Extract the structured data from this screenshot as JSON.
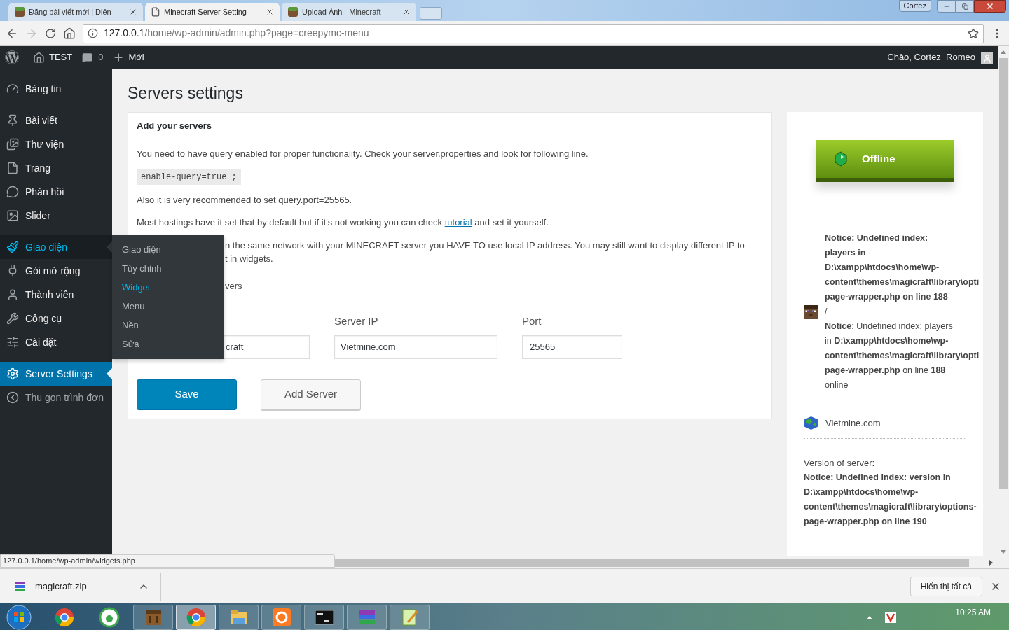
{
  "browser": {
    "tabs": [
      {
        "title": "Đăng bài viết mới | Diễn",
        "selected": false
      },
      {
        "title": "Minecraft Server Setting",
        "selected": true
      },
      {
        "title": "Upload Ảnh - Minecraft",
        "selected": false
      }
    ],
    "profile": "Cortez",
    "url_host": "127.0.0.1",
    "url_path": "/home/wp-admin/admin.php?page=creepymc-menu"
  },
  "admin_bar": {
    "site": "TEST",
    "comments": "0",
    "new": "Mới",
    "greeting": "Chào, Cortez_Romeo"
  },
  "sidebar": {
    "groups": [
      [
        {
          "label": "Bảng tin",
          "selected": false,
          "hovered": false
        }
      ],
      [
        {
          "label": "Bài viết",
          "selected": false,
          "hovered": false
        },
        {
          "label": "Thư viện",
          "selected": false,
          "hovered": false
        },
        {
          "label": "Trang",
          "selected": false,
          "hovered": false
        },
        {
          "label": "Phản hồi",
          "selected": false,
          "hovered": false
        },
        {
          "label": "Slider",
          "selected": false,
          "hovered": false
        }
      ],
      [
        {
          "label": "Giao diện",
          "selected": false,
          "hovered": true
        },
        {
          "label": "Gói mở rộng",
          "selected": false,
          "hovered": false
        },
        {
          "label": "Thành viên",
          "selected": false,
          "hovered": false
        },
        {
          "label": "Công cụ",
          "selected": false,
          "hovered": false
        },
        {
          "label": "Cài đặt",
          "selected": false,
          "hovered": false
        }
      ],
      [
        {
          "label": "Server Settings",
          "selected": true,
          "hovered": false
        },
        {
          "label": "Thu gọn trình đơn",
          "selected": false,
          "hovered": false
        }
      ]
    ],
    "flyout": [
      {
        "label": "Giao diện",
        "highlighted": false
      },
      {
        "label": "Tùy chỉnh",
        "highlighted": false
      },
      {
        "label": "Widget",
        "highlighted": true
      },
      {
        "label": "Menu",
        "highlighted": false
      },
      {
        "label": "Nền",
        "highlighted": false
      },
      {
        "label": "Sửa",
        "highlighted": false
      }
    ]
  },
  "page_title": "Servers settings",
  "card": {
    "heading": "Add your servers",
    "intro": "You need to have query enabled for proper functionality. Check your server.properties and look for following line.",
    "code": "enable-query=true ;",
    "note": "Also it is very recommended to set query.port=25565.",
    "hosting": {
      "before": "Most hostings have it set that by default but if it's not working you can check",
      "link": "tutorial",
      "after": "and set it yourself."
    },
    "partial_lines": [
      "n the same network with your MINECRAFT server you HAVE TO use local IP address. You may still want to display different IP to",
      "t in widgets."
    ],
    "partial_heading": "vers",
    "fields": [
      {
        "value": "craft"
      },
      {
        "label": "Server IP",
        "value": "Vietmine.com"
      },
      {
        "label": "Port",
        "value": "25565"
      }
    ],
    "buttons": [
      {
        "label": "Save",
        "kind": "primary"
      },
      {
        "label": "Add Server",
        "kind": "secondary"
      }
    ]
  },
  "status_panel": {
    "status": "Offline",
    "players_lines": [
      "**Notice: Undefined index:**",
      "**players in**",
      "**D:\\xampp\\htdocs\\home\\wp-**",
      "**content\\themes\\magicraft\\library\\opti**",
      "**page-wrapper.php on line 188**",
      "/",
      "**Notice**: Undefined index: players",
      "in **D:\\xampp\\htdocs\\home\\wp-**",
      "**content\\themes\\magicraft\\library\\opti**",
      "**page-wrapper.php** on line **188**",
      "online"
    ],
    "address": "Vietmine.com",
    "version_label": "Version of server:",
    "version_lines": [
      "Notice: Undefined index: version in",
      "D:\\xampp\\htdocs\\home\\wp-",
      "content\\themes\\magicraft\\library\\options-",
      "page-wrapper.php on line 190"
    ]
  },
  "status_url": "127.0.0.1/home/wp-admin/widgets.php",
  "downloads": {
    "file": "magicraft.zip",
    "show_all": "Hiển thị tất cả"
  },
  "taskbar": {
    "apps": [
      {
        "active": false
      },
      {
        "active": true
      },
      {
        "active": false
      },
      {
        "active": false
      },
      {
        "active": false
      },
      {
        "active": false
      },
      {
        "active": false
      }
    ],
    "clock": "10:25 AM"
  }
}
